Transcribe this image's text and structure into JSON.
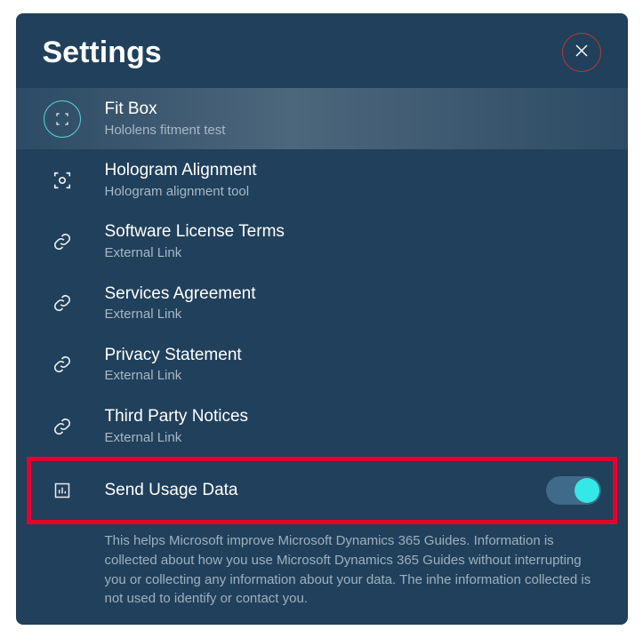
{
  "header": {
    "title": "Settings"
  },
  "items": [
    {
      "title": "Fit Box",
      "sub": "Hololens fitment test",
      "icon": "fitbox",
      "selected": true
    },
    {
      "title": "Hologram Alignment",
      "sub": "Hologram alignment tool",
      "icon": "alignment",
      "selected": false
    },
    {
      "title": "Software License Terms",
      "sub": "External Link",
      "icon": "link",
      "selected": false
    },
    {
      "title": "Services Agreement",
      "sub": "External Link",
      "icon": "link",
      "selected": false
    },
    {
      "title": "Privacy Statement",
      "sub": "External Link",
      "icon": "link",
      "selected": false
    },
    {
      "title": "Third Party Notices",
      "sub": "External Link",
      "icon": "link",
      "selected": false
    }
  ],
  "usage": {
    "label": "Send Usage Data",
    "enabled": true,
    "description": "This helps Microsoft improve Microsoft Dynamics 365 Guides.  Information is collected about how you use Microsoft Dynamics 365 Guides without interrupting you or collecting any information about your data.  The inhe information collected is not used to identify or contact you."
  }
}
